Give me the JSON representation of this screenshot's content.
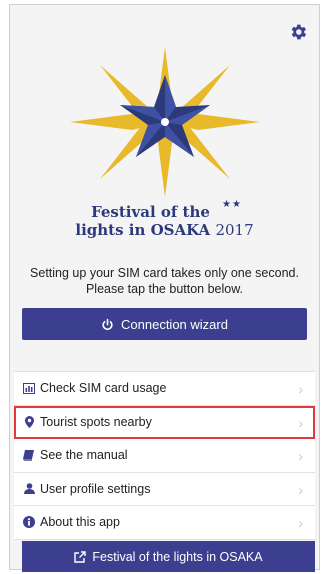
{
  "header": {
    "settings_icon": "gear-icon"
  },
  "logo": {
    "title_line1": "Festival of the",
    "title_line2": "lights in OSAKA",
    "year": "2017",
    "decor_stars": "★★"
  },
  "setup": {
    "line1": "Setting up your SIM card takes only one second.",
    "line2": "Please tap the button below."
  },
  "wizard": {
    "label": "Connection wizard",
    "icon": "power-icon"
  },
  "menu": {
    "items": [
      {
        "label": "Check SIM card usage",
        "icon": "chart-icon"
      },
      {
        "label": "Tourist spots nearby",
        "icon": "map-pin-icon",
        "highlighted": true
      },
      {
        "label": "See the manual",
        "icon": "book-icon"
      },
      {
        "label": "User profile settings",
        "icon": "user-icon"
      },
      {
        "label": "About this app",
        "icon": "info-icon"
      }
    ],
    "chevron": "›"
  },
  "footer_button": {
    "label": "Festival of the lights in OSAKA",
    "icon": "external-link-icon"
  },
  "colors": {
    "brand": "#3c3f8f",
    "star_gold": "#e8b92a",
    "highlight": "#e0393e"
  }
}
